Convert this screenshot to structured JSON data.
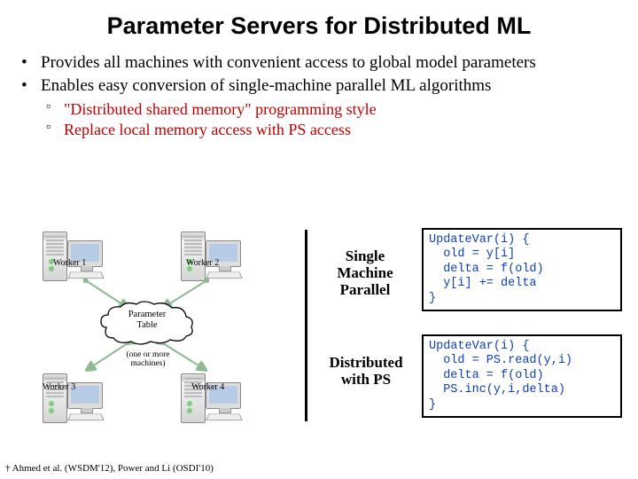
{
  "title": "Parameter Servers for Distributed ML",
  "bullets": {
    "b1a": "Provides all machines with convenient access to global model parameters",
    "b1b": "Enables easy conversion of single-machine parallel ML algorithms",
    "b2a": "\"Distributed shared memory\" programming style",
    "b2b": "Replace local memory access with PS access"
  },
  "diagram": {
    "w1": "Worker 1",
    "w2": "Worker 2",
    "w3": "Worker 3",
    "w4": "Worker 4",
    "cloud_l1": "Parameter",
    "cloud_l2": "Table",
    "caption": "(one or more machines)"
  },
  "right": {
    "label1": "Single Machine Parallel",
    "label2": "Distributed with PS",
    "code1": "UpdateVar(i) {\n  old = y[i]\n  delta = f(old)\n  y[i] += delta\n}",
    "code2": "UpdateVar(i) {\n  old = PS.read(y,i)\n  delta = f(old)\n  PS.inc(y,i,delta)\n}"
  },
  "footnote": "† Ahmed et al. (WSDM'12), Power and Li (OSDI'10)"
}
